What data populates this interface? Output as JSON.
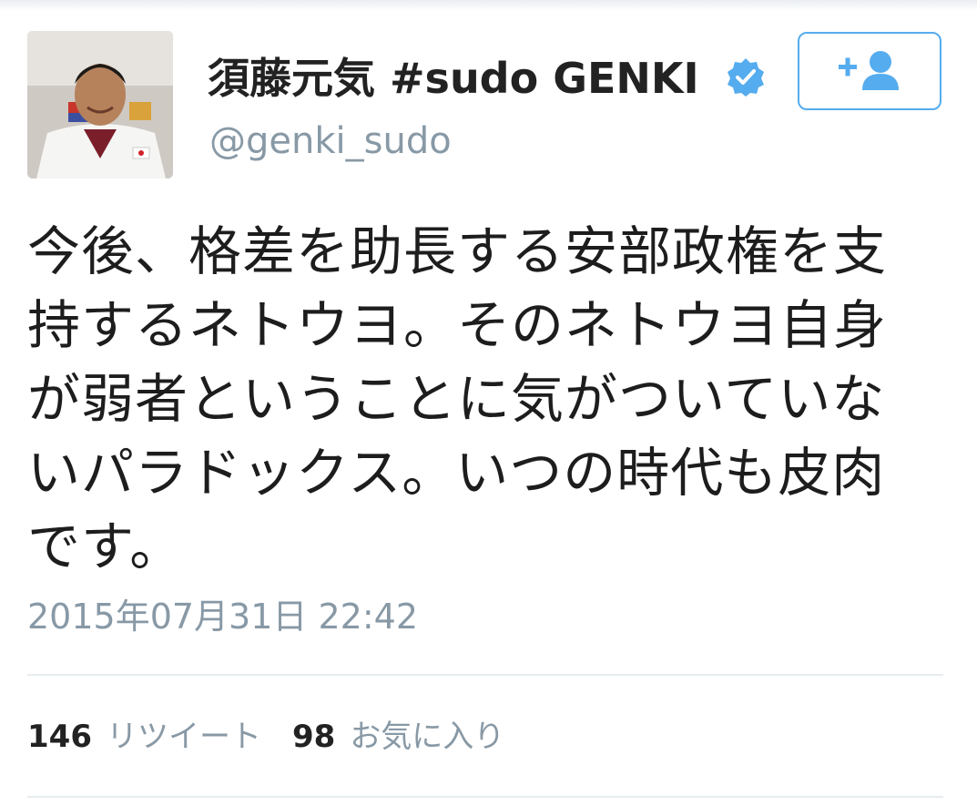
{
  "header": {
    "display_name": "須藤元気  #sudo GENKI",
    "handle": "@genki_sudo",
    "verified_icon": "verified-badge-icon",
    "follow_icon": "add-user-icon"
  },
  "tweet": {
    "lines": [
      "今後、格差を助長する安部政権を支",
      "持するネトウヨ。そのネトウヨ自身",
      "が弱者ということに気がついていな",
      "いパラドックス。いつの時代も皮肉",
      "です。"
    ],
    "timestamp": "2015年07月31日 22:42"
  },
  "stats": {
    "retweets_count": "146",
    "retweets_label": "リツイート",
    "favorites_count": "98",
    "favorites_label": "お気に入り"
  },
  "colors": {
    "accent": "#55acee",
    "muted": "#8899a6",
    "divider": "#e6ecf0"
  }
}
